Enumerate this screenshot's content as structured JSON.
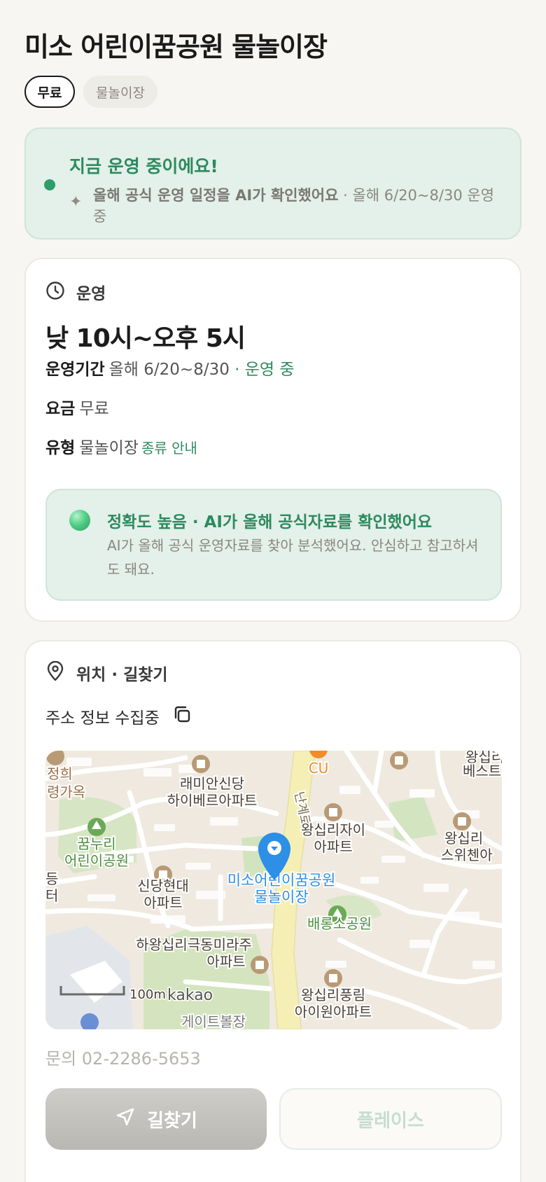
{
  "title": "미소 어린이꿈공원 물놀이장",
  "chips": [
    "무료",
    "물놀이장"
  ],
  "status": {
    "title": "지금 운영 중이에요!",
    "desc_bold": "올해 공식 운영 일정을 AI가 확인했어요",
    "desc_rest": " · 올해 6/20~8/30 운영 중"
  },
  "hours_card": {
    "section_label": "운영",
    "hours": "낮 10시~오후 5시",
    "period_key": "운영기간",
    "period_value": "올해 6/20~8/30",
    "period_status": " · 운영 중",
    "fee_key": "요금",
    "fee_value": "무료",
    "type_key": "유형",
    "type_value": "물놀이장",
    "type_link": "종류 안내",
    "ai_title": "정확도 높음 · AI가 올해 공식자료를 확인했어요",
    "ai_desc": "AI가 올해 공식 운영자료를 찾아 분석했어요. 안심하고 참고하셔도 돼요."
  },
  "location_card": {
    "section_label": "위치 · 길찾기",
    "address": "주소 정보 수집중",
    "phone": "문의 02-2286-5653",
    "directions_label": "길찾기",
    "place_label": "플레이스"
  },
  "map": {
    "labels": {
      "jeonghui": "정희",
      "ryeonggaok": "령가옥",
      "raemian_1": "래미안신당",
      "raemian_2": "하이베르아파트",
      "cu": "CU",
      "wangsimni_top_1": "왕십리다",
      "wangsimni_top_2": "베스트빌",
      "road": "난계로",
      "kkumnuri_1": "꿈누리",
      "kkumnuri_2": "어린이공원",
      "wangsimni_zai_1": "왕십리자이",
      "wangsimni_zai_2": "아파트",
      "wangsimni_sw_1": "왕십리",
      "wangsimni_sw_2": "스위첸아",
      "sindang_1": "신당현대",
      "sindang_2": "아파트",
      "target_1": "미소어린이꿈공원",
      "target_2": "물놀이장",
      "baeryongso": "배롱소공원",
      "edge_1": "등",
      "edge_2": "터",
      "hawang_1": "하왕십리극동미라주",
      "hawang_2": "아파트",
      "pungnim_1": "왕십리풍림",
      "pungnim_2": "아이원아파트",
      "scale": "100m",
      "brand": "kakao",
      "gate": "게이트볼장"
    },
    "colors": {
      "land": "#efe9e0",
      "road": "#ffffff",
      "main_road": "#f6f0b8",
      "park": "#cfe3b5",
      "pin": "#2d8fe6",
      "poi": "#b89a74"
    }
  }
}
